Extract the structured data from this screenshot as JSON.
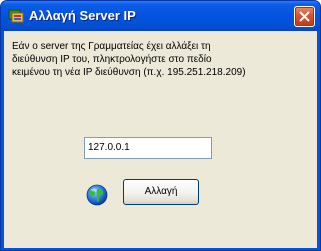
{
  "window": {
    "title": "Αλλαγή Server IP",
    "title_icon": "app-window-icon",
    "close_icon": "close-icon"
  },
  "dialog": {
    "message": "Εάν ο server της Γραμματείας έχει αλλάξει τη\nδιεύθυνση IP του, πληκτρολογήστε στο πεδίο\nκειμένου τη νέα IP διεύθυνση (π.χ. 195.251.218.209)",
    "ip_value": "127.0.0.1",
    "globe_icon": "globe-icon",
    "change_label": "Αλλαγή"
  },
  "colors": {
    "titlebar": "#0454e0",
    "client_bg": "#ece9d8",
    "close_button": "#d8532f"
  }
}
